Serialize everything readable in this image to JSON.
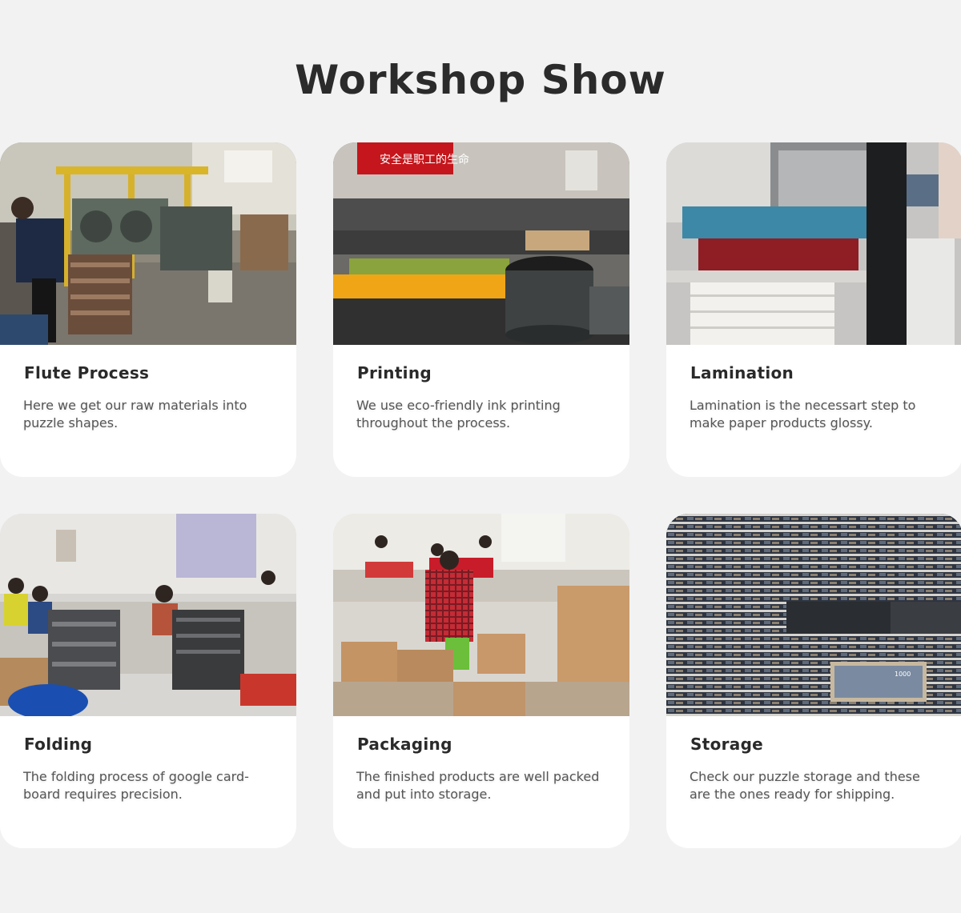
{
  "page": {
    "title": "Workshop Show"
  },
  "cards": [
    {
      "title": "Flute Process",
      "description": "Here we get our raw materials into puzzle shapes.",
      "image": "corrugated-flute-machine-photo"
    },
    {
      "title": "Printing",
      "description": "We use eco-friendly ink printing throughout the process.",
      "image": "printing-press-photo",
      "banner_text": "安全是职工的生命"
    },
    {
      "title": "Lamination",
      "description": "Lamination is the necessart step to make paper products glossy.",
      "image": "lamination-machine-photo"
    },
    {
      "title": "Folding",
      "description": "The folding process of google card-board requires precision.",
      "image": "folding-workers-photo"
    },
    {
      "title": "Packaging",
      "description": "The finished products are well packed and put into storage.",
      "image": "packaging-workers-photo"
    },
    {
      "title": "Storage",
      "description": "Check our puzzle storage and these are the ones ready for shipping.",
      "image": "puzzle-storage-photo",
      "box_label": "1000"
    }
  ],
  "colors": {
    "background": "#f2f2f2",
    "card": "#ffffff",
    "title": "#2b2b2b",
    "text": "#555555"
  }
}
